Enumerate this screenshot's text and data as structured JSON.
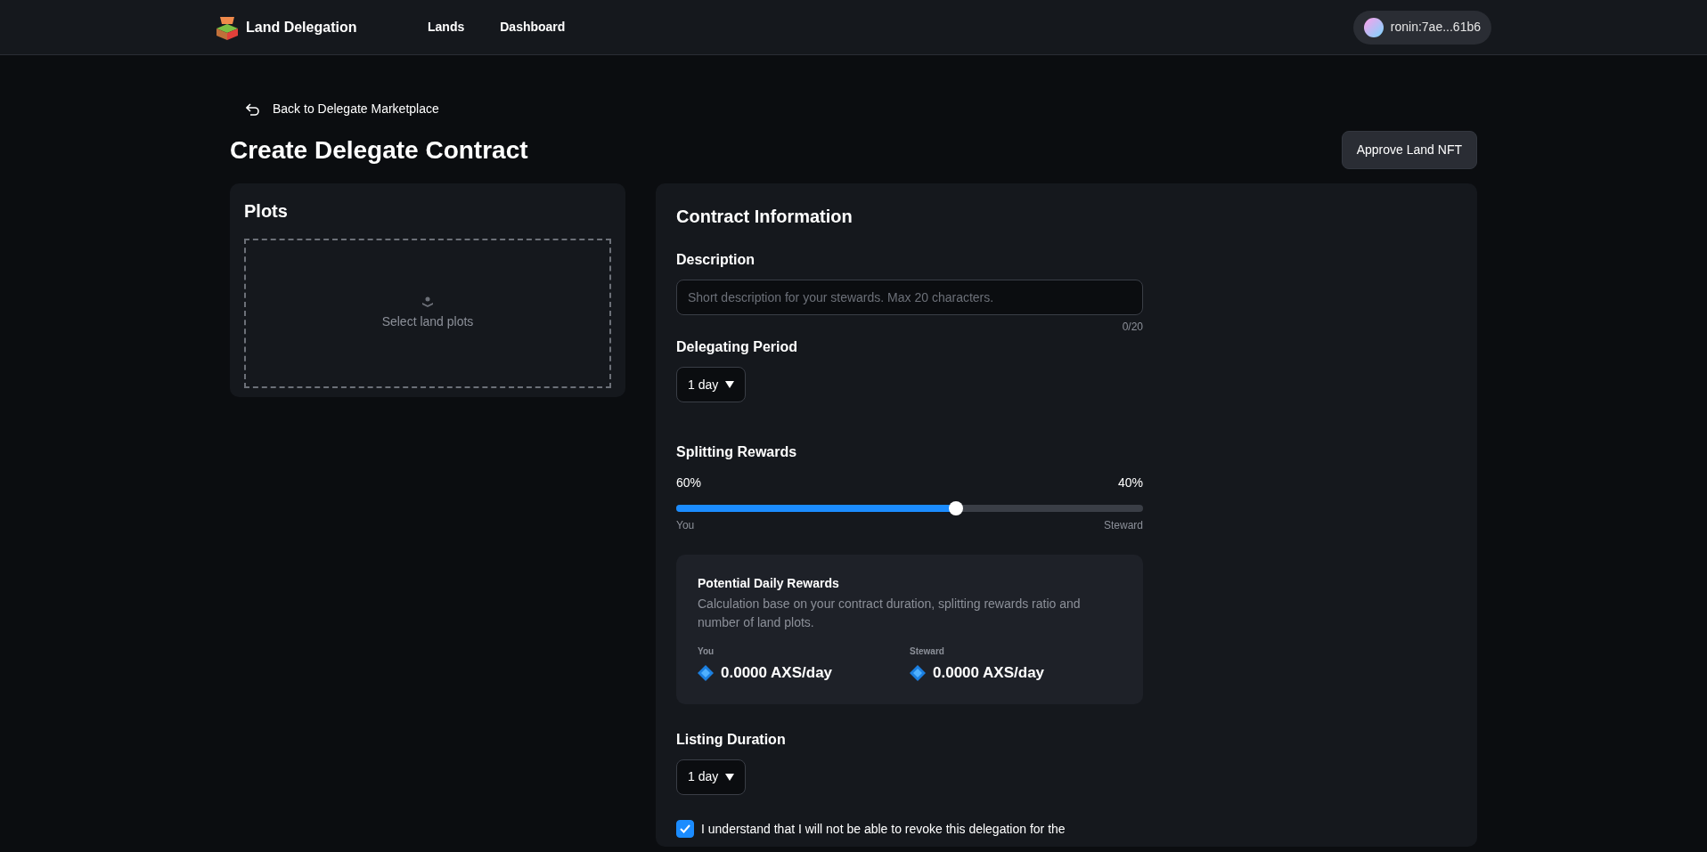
{
  "header": {
    "brand": "Land Delegation",
    "nav": [
      {
        "label": "Lands",
        "selected": false
      },
      {
        "label": "Dashboard",
        "selected": false
      }
    ],
    "wallet": "ronin:7ae...61b6"
  },
  "back_link": "Back to Delegate Marketplace",
  "title": "Create Delegate Contract",
  "approve_button": "Approve Land NFT",
  "plots": {
    "title": "Plots",
    "empty_text": "Select land plots"
  },
  "contract": {
    "title": "Contract Information",
    "description": {
      "label": "Description",
      "placeholder": "Short description for your stewards. Max 20 characters.",
      "counter": "0/20"
    },
    "delegating_period": {
      "label": "Delegating Period",
      "value": "1 day"
    },
    "splitting": {
      "label": "Splitting Rewards",
      "left_value": "60%",
      "right_value": "40%",
      "level": 0.6,
      "left_label": "You",
      "right_label": "Steward"
    },
    "rewards": {
      "title": "Potential Daily Rewards",
      "note": "Calculation base on your contract duration, splitting rewards ratio and number of land plots.",
      "items": [
        {
          "label": "You",
          "amount": "0.0000 AXS/day"
        },
        {
          "label": "Steward",
          "amount": "0.0000 AXS/day"
        }
      ]
    },
    "listing_duration": {
      "label": "Listing Duration",
      "value": "1 day"
    },
    "agreement": {
      "text": "I understand that I will not be able to revoke this delegation for the",
      "checked": true
    }
  }
}
